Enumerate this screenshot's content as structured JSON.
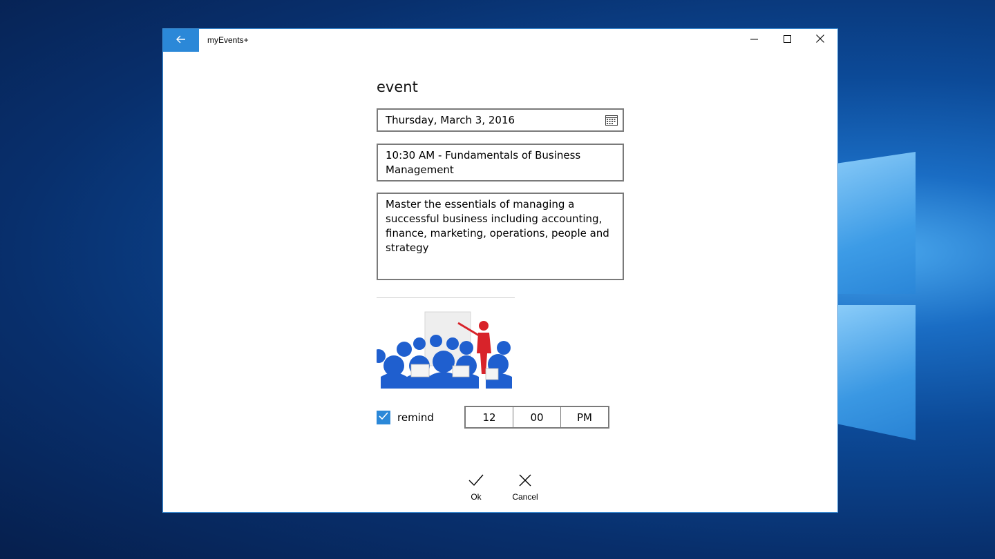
{
  "window": {
    "title": "myEvents+",
    "accent_color": "#2b88d8"
  },
  "titlebar": {
    "back_icon": "arrow-left-icon",
    "minimize_icon": "minimize-icon",
    "maximize_icon": "maximize-icon",
    "close_icon": "close-icon"
  },
  "form": {
    "heading": "event",
    "date": "Thursday, March 3, 2016",
    "date_icon": "calendar-icon",
    "event_title": "10:30 AM - Fundamentals of Business Management",
    "description": "Master the essentials of managing a successful business including accounting, finance, marketing, operations, people and strategy",
    "image_alt": "presentation-illustration",
    "remind": {
      "label": "remind",
      "checked": true,
      "hour": "12",
      "minute": "00",
      "period": "PM"
    }
  },
  "commands": {
    "ok_label": "Ok",
    "ok_icon": "checkmark-icon",
    "cancel_label": "Cancel",
    "cancel_icon": "cancel-x-icon"
  }
}
